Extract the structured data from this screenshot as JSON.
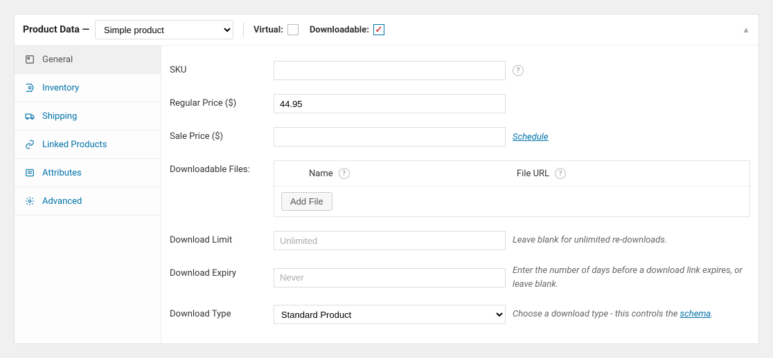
{
  "header": {
    "title": "Product Data —",
    "product_type": "Simple product",
    "virtual_label": "Virtual:",
    "virtual_checked": false,
    "downloadable_label": "Downloadable:",
    "downloadable_checked": true
  },
  "tabs": [
    {
      "id": "general",
      "label": "General",
      "icon": "wrench-icon",
      "active": true
    },
    {
      "id": "inventory",
      "label": "Inventory",
      "icon": "clipboard-icon",
      "active": false
    },
    {
      "id": "shipping",
      "label": "Shipping",
      "icon": "truck-icon",
      "active": false
    },
    {
      "id": "linked",
      "label": "Linked Products",
      "icon": "link-icon",
      "active": false
    },
    {
      "id": "attributes",
      "label": "Attributes",
      "icon": "list-icon",
      "active": false
    },
    {
      "id": "advanced",
      "label": "Advanced",
      "icon": "gear-icon",
      "active": false
    }
  ],
  "form": {
    "sku": {
      "label": "SKU",
      "value": ""
    },
    "regular_price": {
      "label": "Regular Price ($)",
      "value": "44.95"
    },
    "sale_price": {
      "label": "Sale Price ($)",
      "value": "",
      "schedule_link": "Schedule"
    },
    "downloadable_files": {
      "label": "Downloadable Files:",
      "col_name": "Name",
      "col_url": "File URL",
      "add_button": "Add File"
    },
    "download_limit": {
      "label": "Download Limit",
      "placeholder": "Unlimited",
      "value": "",
      "help": "Leave blank for unlimited re-downloads."
    },
    "download_expiry": {
      "label": "Download Expiry",
      "placeholder": "Never",
      "value": "",
      "help": "Enter the number of days before a download link expires, or leave blank."
    },
    "download_type": {
      "label": "Download Type",
      "value": "Standard Product",
      "help_prefix": "Choose a download type - this controls the ",
      "help_link": "schema",
      "help_suffix": "."
    }
  }
}
